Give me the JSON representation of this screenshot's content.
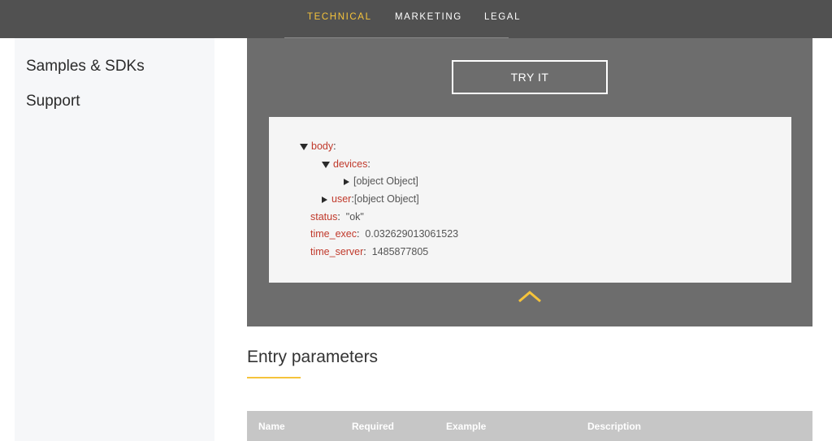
{
  "nav": {
    "tabs": [
      {
        "label": "TECHNICAL",
        "active": true
      },
      {
        "label": "MARKETING",
        "active": false
      },
      {
        "label": "LEGAL",
        "active": false
      }
    ]
  },
  "sidebar": {
    "items": [
      {
        "label": "Samples & SDKs"
      },
      {
        "label": "Support"
      }
    ]
  },
  "console": {
    "try_button": "TRY IT",
    "response": {
      "body_key": "body",
      "devices_key": "devices",
      "devices_value": "[object Object]",
      "user_key": "user",
      "user_value": "[object Object]",
      "status_key": "status",
      "status_value": "\"ok\"",
      "time_exec_key": "time_exec",
      "time_exec_value": "0.032629013061523",
      "time_server_key": "time_server",
      "time_server_value": "1485877805"
    },
    "collapse_icon": "chevron-up-icon"
  },
  "entry_parameters": {
    "title": "Entry parameters",
    "columns": [
      "Name",
      "Required",
      "Example",
      "Description"
    ]
  },
  "colors": {
    "accent": "#f5c33b",
    "topbar": "#515151",
    "console_bg": "#6d6d6d",
    "json_key": "#c0392b"
  }
}
